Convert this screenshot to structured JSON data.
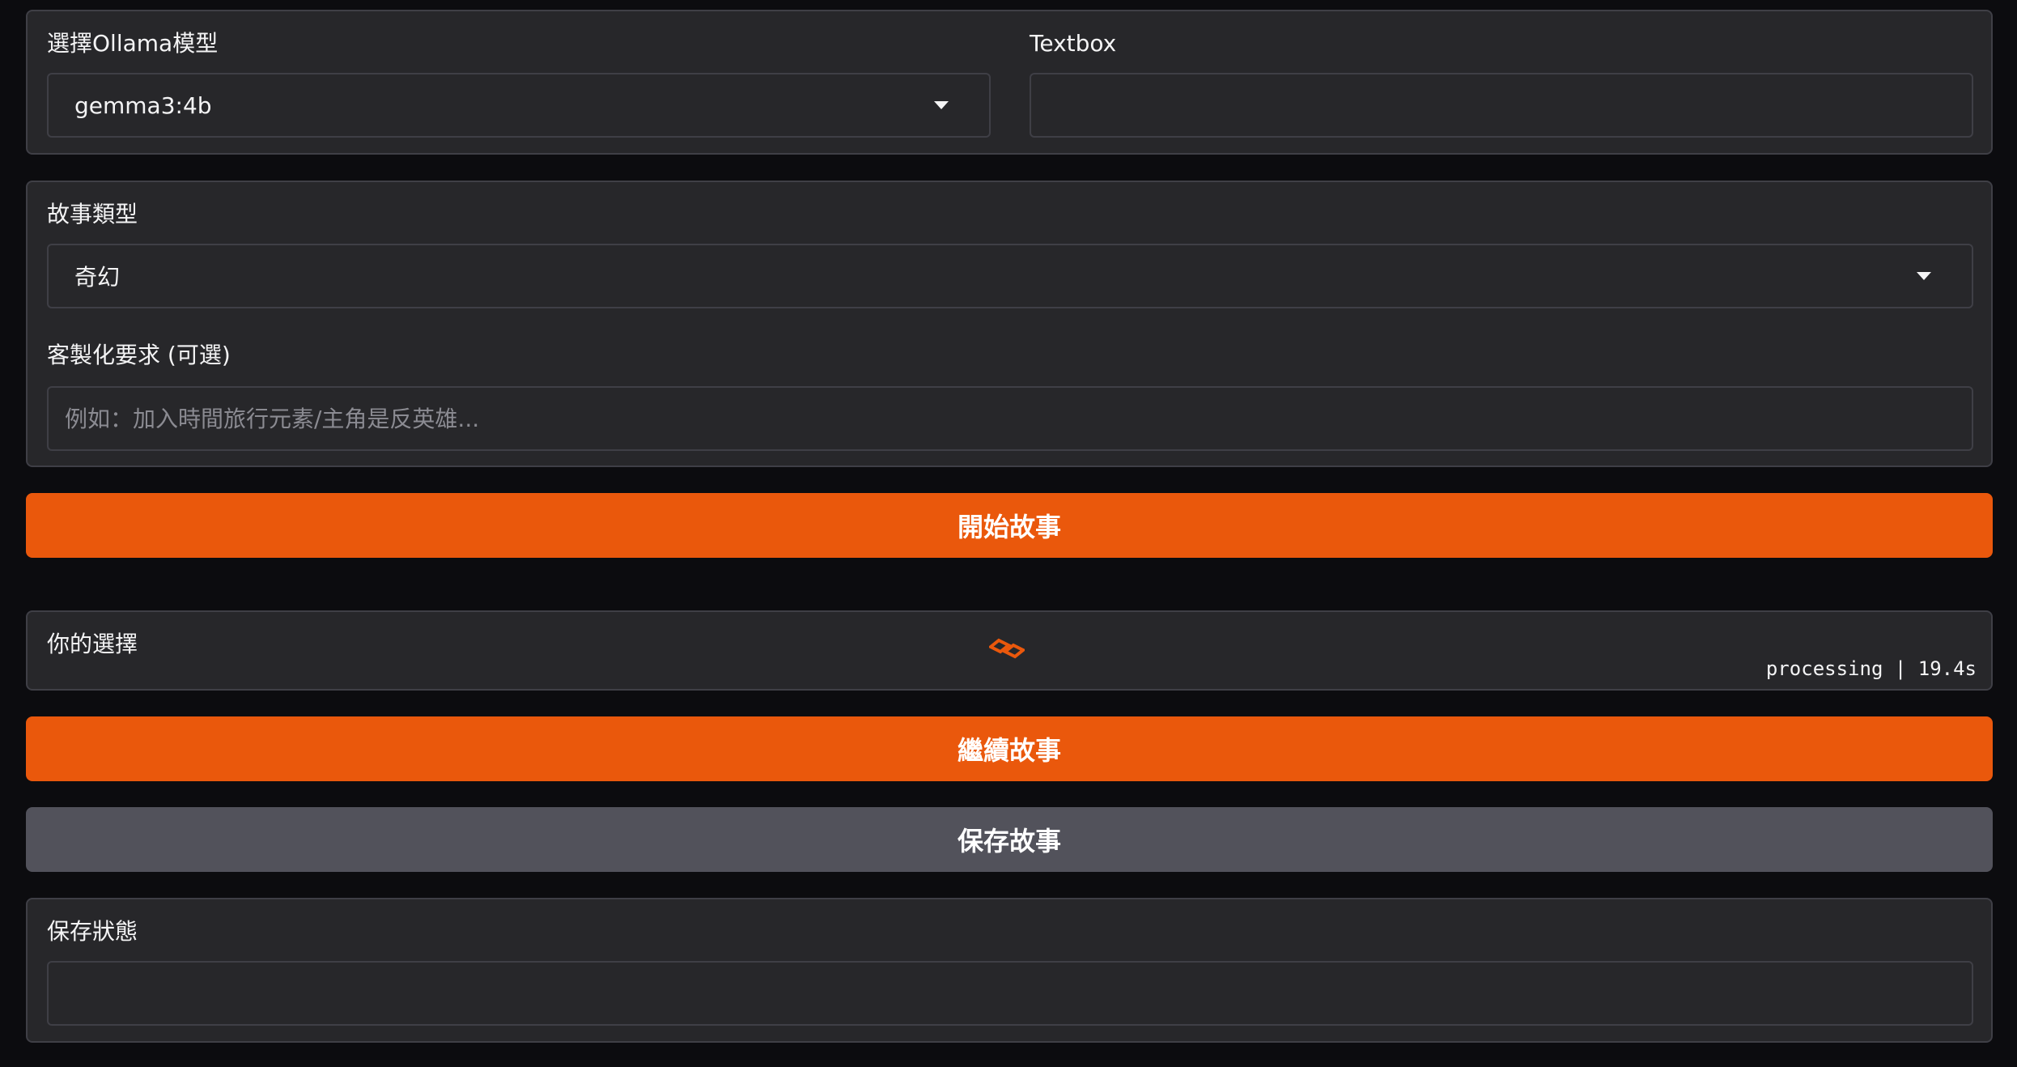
{
  "model_panel": {
    "model_label": "選擇Ollama模型",
    "model_value": "gemma3:4b",
    "textbox_label": "Textbox",
    "textbox_value": ""
  },
  "story_panel": {
    "genre_label": "故事類型",
    "genre_value": "奇幻",
    "custom_label": "客製化要求 (可選)",
    "custom_placeholder": "例如：加入時間旅行元素/主角是反英雄...",
    "custom_value": ""
  },
  "buttons": {
    "start_label": "開始故事",
    "continue_label": "繼續故事",
    "save_label": "保存故事"
  },
  "choice_panel": {
    "label": "你的選擇",
    "status": "processing | 19.4s",
    "loader_icon": "loading-spinner-icon"
  },
  "save_status_panel": {
    "label": "保存狀態",
    "value": ""
  },
  "colors": {
    "primary_button": "#ea580c",
    "secondary_button": "#52525b",
    "panel_background": "#27272a",
    "page_background": "#0c0c0f"
  }
}
